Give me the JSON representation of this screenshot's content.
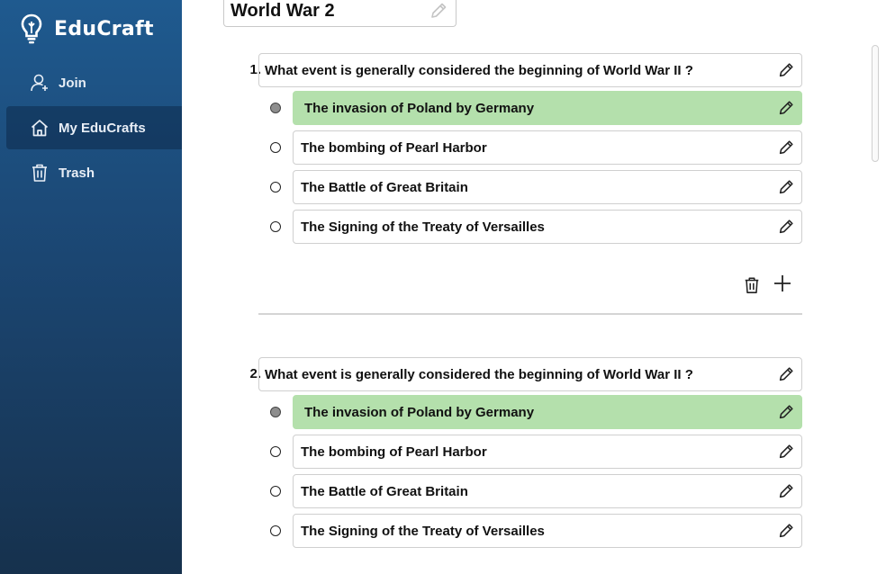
{
  "app": {
    "name": "EduCraft",
    "logo_icon": "lightbulb-icon",
    "accent": "#1f5a8f",
    "correct_color": "#b4e0ac"
  },
  "sidebar": {
    "items": [
      {
        "label": "Join",
        "icon": "user-add-icon"
      },
      {
        "label": "My EduCrafts",
        "icon": "home-icon",
        "active": true
      },
      {
        "label": "Trash",
        "icon": "trash-icon"
      }
    ]
  },
  "quiz": {
    "title": "World War 2",
    "questions": [
      {
        "number": "1.",
        "text": "What event is generally considered the beginning of World War II ?",
        "options": [
          {
            "text": "The invasion of Poland by Germany",
            "correct": true
          },
          {
            "text": "The bombing of Pearl Harbor",
            "correct": false
          },
          {
            "text": "The Battle of Great Britain",
            "correct": false
          },
          {
            "text": "The Signing of the Treaty of Versailles",
            "correct": false
          }
        ]
      },
      {
        "number": "2.",
        "text": "What event is generally considered the beginning of World War II ?",
        "options": [
          {
            "text": "The invasion of Poland by Germany",
            "correct": true
          },
          {
            "text": "The bombing of Pearl Harbor",
            "correct": false
          },
          {
            "text": "The Battle of Great Britain",
            "correct": false
          },
          {
            "text": "The Signing of the Treaty of Versailles",
            "correct": false
          }
        ]
      }
    ]
  }
}
